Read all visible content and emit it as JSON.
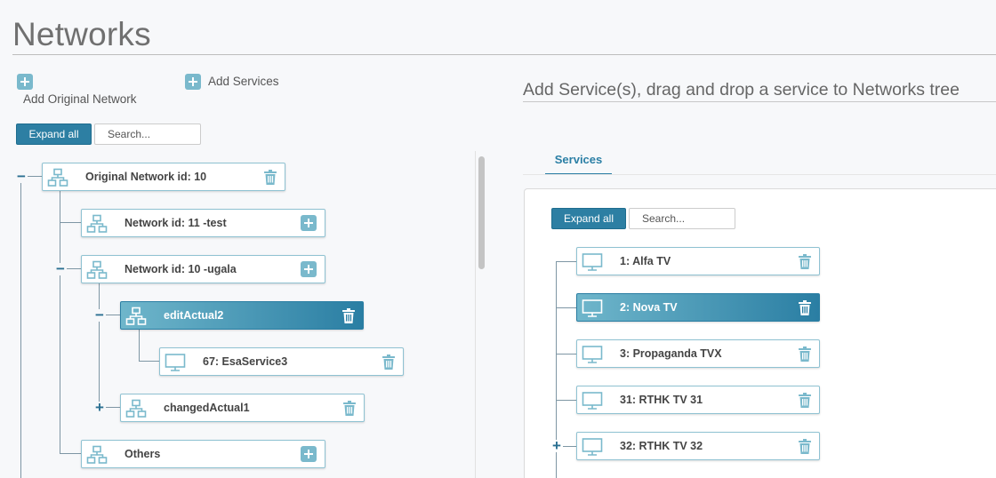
{
  "page": {
    "title": "Networks"
  },
  "actions": {
    "add_original_network": "Add Original Network",
    "add_services": "Add Services"
  },
  "left": {
    "expand_all": "Expand all",
    "search_placeholder": "Search...",
    "tree": {
      "root": "Original Network id: 10",
      "network_11": "Network id: 11 -test",
      "network_10": "Network id: 10 -ugala",
      "edit_actual": "editActual2",
      "service_67": "67: EsaService3",
      "changed_actual": "changedActual1",
      "others": "Others"
    }
  },
  "right": {
    "heading": "Add Service(s), drag and drop a service to Networks tree",
    "tab": "Services",
    "expand_all": "Expand all",
    "search_placeholder": "Search...",
    "services": [
      "1: Alfa TV",
      "2: Nova TV",
      "3: Propaganda TVX",
      "31: RTHK TV 31",
      "32: RTHK TV 32"
    ]
  },
  "icons": {
    "add": "plus-square-icon",
    "network": "network-icon",
    "service": "monitor-icon",
    "delete": "trash-icon",
    "collapse": "minus-icon",
    "expand": "plus-icon"
  },
  "colors": {
    "accent": "#2d7fa3",
    "node_border": "#8fc2d2",
    "icon": "#7ab9cc"
  }
}
